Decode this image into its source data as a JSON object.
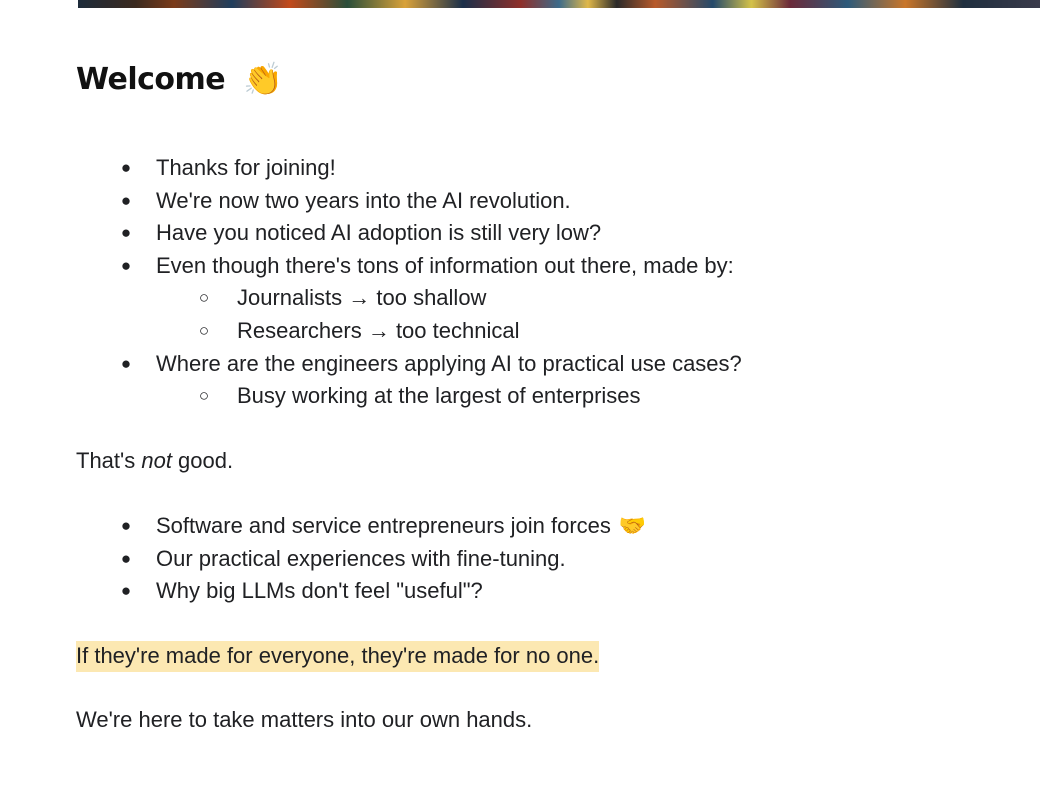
{
  "heading": {
    "title": "Welcome",
    "emoji": "👏"
  },
  "list1": [
    {
      "text": "Thanks for joining!",
      "level": 1
    },
    {
      "text": "We're now two years into the AI revolution.",
      "level": 1
    },
    {
      "text": "Have you noticed AI adoption is still very low?",
      "level": 1
    },
    {
      "text": "Even though there's tons of information out there, made by:",
      "level": 1
    },
    {
      "text": "Journalists → too shallow",
      "level": 2
    },
    {
      "text": "Researchers → too technical",
      "level": 2
    },
    {
      "text": "Where are the engineers applying AI to practical use cases?",
      "level": 1
    },
    {
      "text": "Busy working at the largest of enterprises",
      "level": 2
    }
  ],
  "paragraph1": {
    "before": "That's ",
    "emphasis": "not",
    "after": " good."
  },
  "list2": [
    {
      "text": "Software and service entrepreneurs join forces",
      "emoji": "🤝"
    },
    {
      "text": "Our practical experiences with fine-tuning."
    },
    {
      "text": "Why big LLMs don't feel \"useful\"?"
    }
  ],
  "highlighted_line": "If they're made for everyone, they're made for no one.",
  "closing_line": "We're here to take matters into our own hands.",
  "bullets": {
    "level1": "●",
    "level2": "○"
  },
  "colors": {
    "highlight": "#fce8b2",
    "text": "#202124"
  }
}
